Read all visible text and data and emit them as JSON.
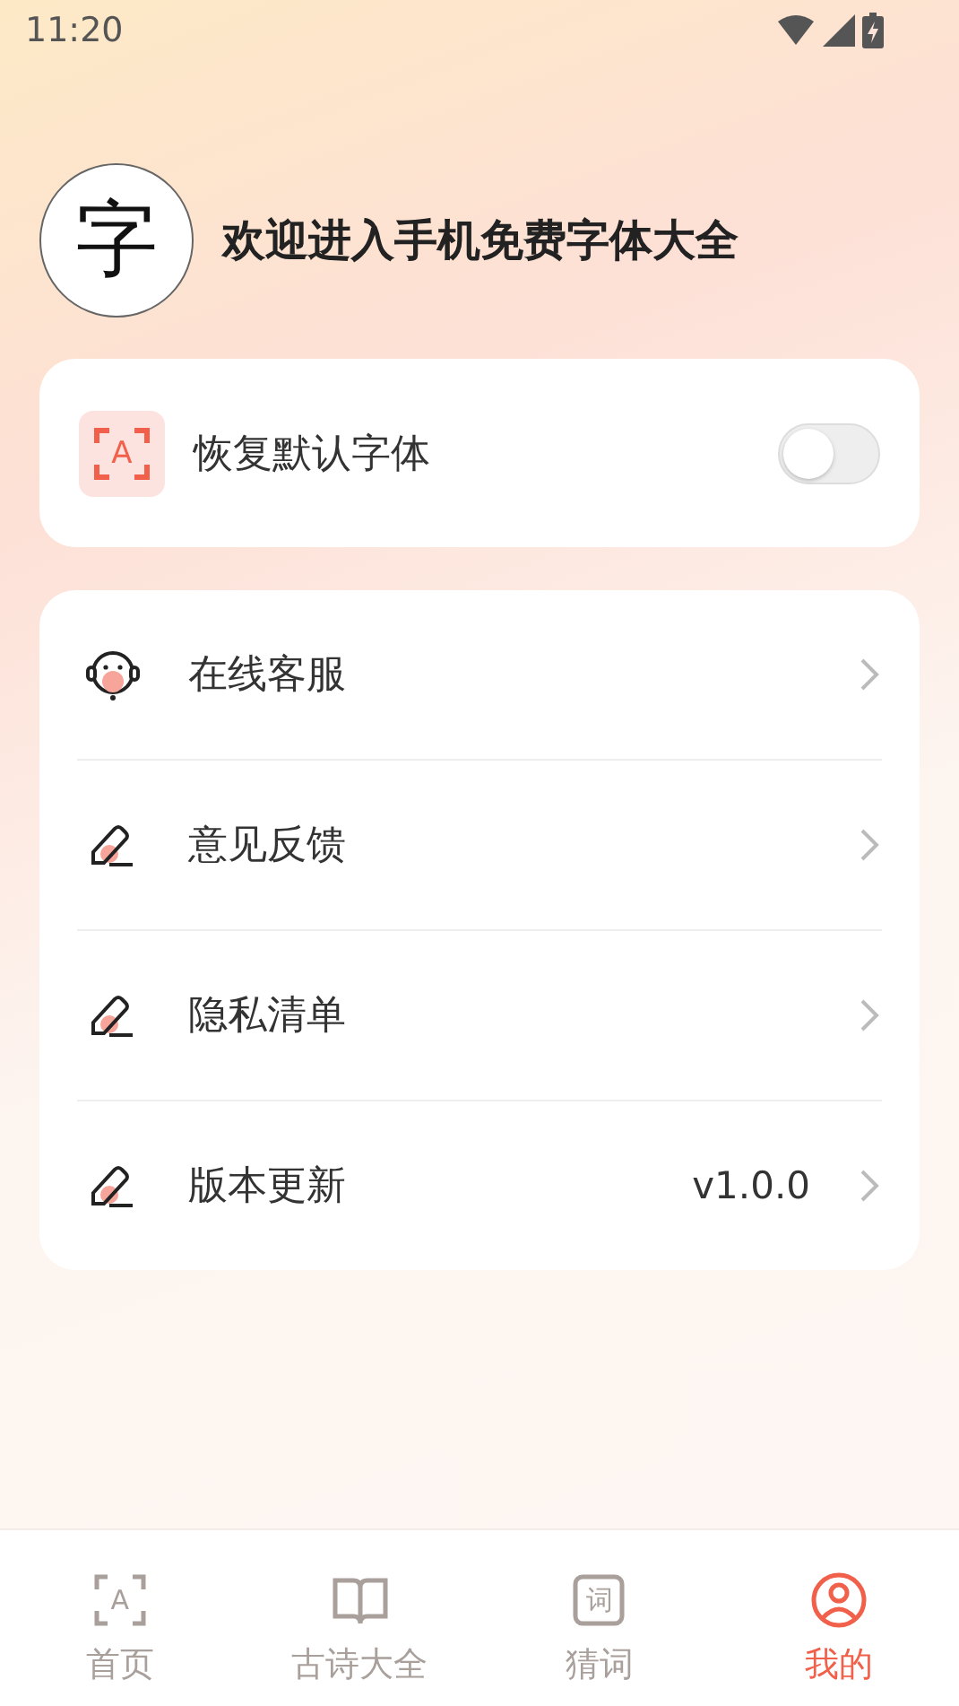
{
  "status_bar": {
    "time": "11:20"
  },
  "profile": {
    "logo_text": "字",
    "title": "欢迎进入手机免费字体大全"
  },
  "restore_card": {
    "icon_letter": "A",
    "label": "恢复默认字体",
    "on": false
  },
  "menu": [
    {
      "kind": "service",
      "label": "在线客服"
    },
    {
      "kind": "edit",
      "label": "意见反馈"
    },
    {
      "kind": "edit",
      "label": "隐私清单"
    },
    {
      "kind": "edit",
      "label": "版本更新",
      "value": "v1.0.0"
    }
  ],
  "tabs": [
    {
      "kind": "font",
      "icon_letter": "A",
      "label": "首页",
      "selected": false
    },
    {
      "kind": "book",
      "label": "古诗大全",
      "selected": false
    },
    {
      "kind": "word",
      "icon_letter": "词",
      "label": "猜词",
      "selected": false
    },
    {
      "kind": "user",
      "label": "我的",
      "selected": true
    }
  ]
}
